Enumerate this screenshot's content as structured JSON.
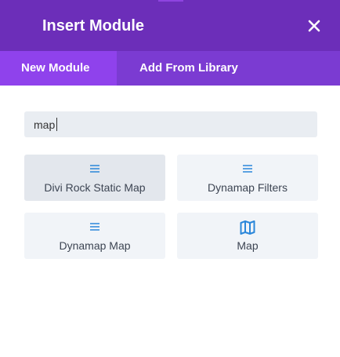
{
  "modal": {
    "title": "Insert Module",
    "close_icon": "close-icon",
    "accent_color": "#6c2eb9"
  },
  "tabs": [
    {
      "label": "New Module",
      "active": true
    },
    {
      "label": "Add From Library",
      "active": false
    }
  ],
  "search": {
    "value": "map",
    "placeholder": ""
  },
  "modules": [
    {
      "label": "Divi Rock Static Map",
      "icon": "list-icon"
    },
    {
      "label": "Dynamap Filters",
      "icon": "list-icon"
    },
    {
      "label": "Dynamap Map",
      "icon": "list-icon"
    },
    {
      "label": "Map",
      "icon": "map-icon"
    }
  ],
  "colors": {
    "header": "#6c2eb9",
    "tab_bar": "#7b3bd2",
    "active_tab": "#8f42ec",
    "icon_blue": "#2b87da"
  }
}
